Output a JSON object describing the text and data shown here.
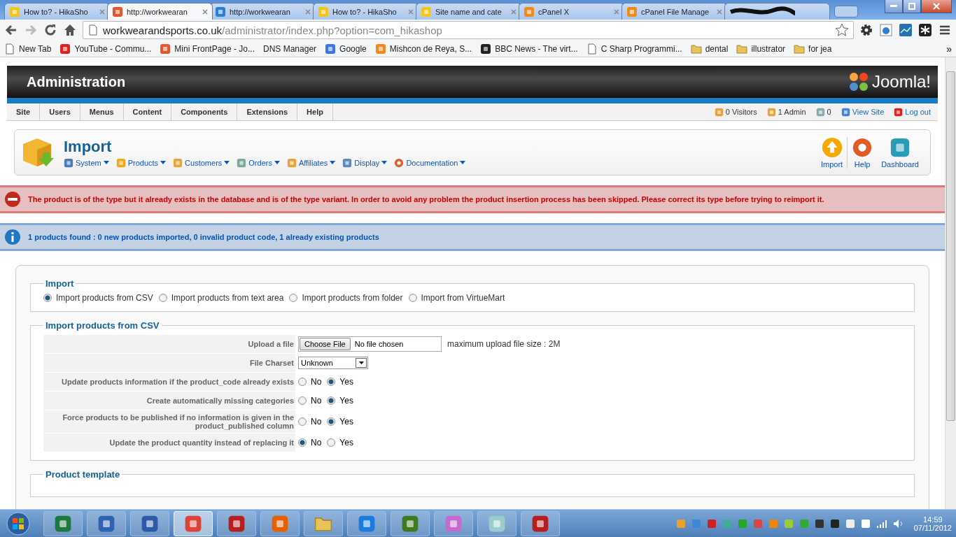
{
  "browser": {
    "tabs": [
      {
        "title": "How to? - HikaSho",
        "selected": false
      },
      {
        "title": "http://workwearan",
        "selected": true
      },
      {
        "title": "http://workwearan",
        "selected": false
      },
      {
        "title": "How to? - HikaSho",
        "selected": false
      },
      {
        "title": "Site name and cate",
        "selected": false
      },
      {
        "title": "cPanel X",
        "selected": false
      },
      {
        "title": "cPanel File Manage",
        "selected": false
      },
      {
        "selected": false
      }
    ],
    "address": {
      "domain": "workwearandsports.co.uk",
      "path": "/administrator/index.php?option=com_hikashop"
    },
    "bookmarks": [
      "New Tab",
      "YouTube - Commu...",
      "Mini FrontPage - Jo...",
      "DNS Manager",
      "Google",
      "Mishcon de Reya, S...",
      "BBC News - The virt...",
      "C Sharp Programmi...",
      "dental",
      "illustrator",
      "for jea"
    ],
    "more": "»"
  },
  "admin": {
    "title": "Administration",
    "logo": "Joomla!",
    "menu": [
      "Site",
      "Users",
      "Menus",
      "Content",
      "Components",
      "Extensions",
      "Help"
    ],
    "status": [
      "0 Visitors",
      "1 Admin",
      "0",
      "View Site",
      "Log out"
    ]
  },
  "toolbar": {
    "title": "Import",
    "submenu": [
      "System",
      "Products",
      "Customers",
      "Orders",
      "Affiliates",
      "Display",
      "Documentation"
    ],
    "buttons": [
      "Import",
      "Help",
      "Dashboard"
    ]
  },
  "messages": [
    {
      "kind": "error",
      "text": "The product is of the type but it already exists in the database and is of the type variant. In order to avoid any problem the product insertion process has been skipped. Please correct its type before trying to reimport it."
    },
    {
      "kind": "info",
      "text": "1 products found : 0 new products imported, 0 invalid product code, 1 already existing products"
    }
  ],
  "import": {
    "legend": "Import",
    "options": [
      {
        "label": "Import products from CSV",
        "selected": true
      },
      {
        "label": "Import products from text area",
        "selected": false
      },
      {
        "label": "Import products from folder",
        "selected": false
      },
      {
        "label": "Import from VirtueMart",
        "selected": false
      }
    ]
  },
  "csv": {
    "legend": "Import products from CSV",
    "rows": [
      {
        "kind": "file",
        "label": "Upload a file",
        "button": "Choose File",
        "value": "No file chosen",
        "note": "maximum upload file size : 2M"
      },
      {
        "kind": "select",
        "label": "File Charset",
        "value": "Unknown"
      },
      {
        "kind": "radio",
        "label": "Update products information if the product_code already exists",
        "options": [
          {
            "label": "No",
            "selected": false
          },
          {
            "label": "Yes",
            "selected": true
          }
        ]
      },
      {
        "kind": "radio",
        "label": "Create automatically missing categories",
        "options": [
          {
            "label": "No",
            "selected": false
          },
          {
            "label": "Yes",
            "selected": true
          }
        ]
      },
      {
        "kind": "radio",
        "label": "Force products to be published if no information is given in the product_published column",
        "options": [
          {
            "label": "No",
            "selected": false
          },
          {
            "label": "Yes",
            "selected": true
          }
        ]
      },
      {
        "kind": "radio",
        "label": "Update the product quantity instead of replacing it",
        "options": [
          {
            "label": "No",
            "selected": true
          },
          {
            "label": "Yes",
            "selected": false
          }
        ]
      }
    ]
  },
  "template": {
    "legend": "Product template"
  },
  "taskbar": {
    "apps": [
      {
        "selected": false
      },
      {
        "selected": false
      },
      {
        "selected": false
      },
      {
        "selected": true
      },
      {
        "selected": false
      },
      {
        "selected": false
      },
      {
        "selected": false
      },
      {
        "selected": false
      },
      {
        "selected": false
      },
      {
        "selected": false
      },
      {
        "selected": false
      },
      {
        "selected": false
      }
    ],
    "time": "14:59",
    "date": "07/11/2012"
  }
}
